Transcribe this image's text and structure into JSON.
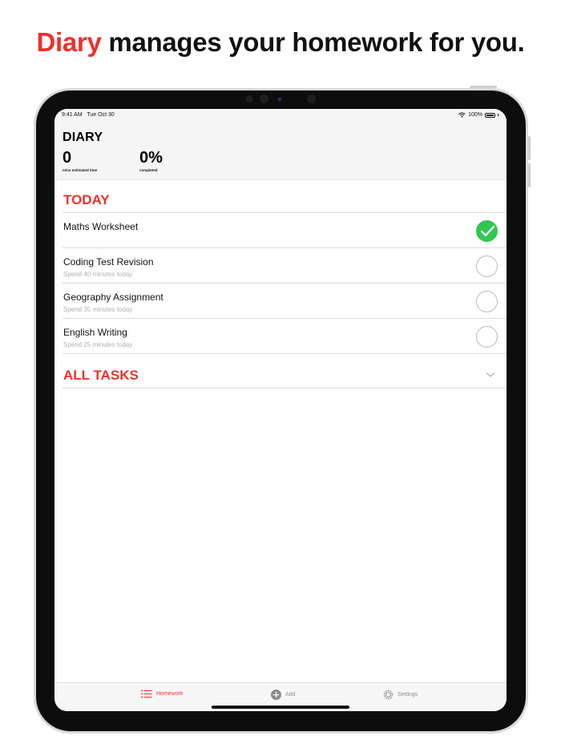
{
  "headline": {
    "accent": "Diary",
    "rest": " manages your homework for you."
  },
  "status_bar": {
    "time": "9:41 AM",
    "date": "Tue Oct 30",
    "battery": "100%"
  },
  "app": {
    "title": "DIARY",
    "stats": [
      {
        "value": "0",
        "caption": "mins estimated time"
      },
      {
        "value": "0%",
        "caption": "completed"
      }
    ]
  },
  "today": {
    "title": "TODAY",
    "tasks": [
      {
        "name": "Maths Worksheet",
        "subtitle": "",
        "done": true
      },
      {
        "name": "Coding Test Revision",
        "subtitle": "Spend 40 minutes today",
        "done": false
      },
      {
        "name": "Geography Assignment",
        "subtitle": "Spend 35 minutes today",
        "done": false
      },
      {
        "name": "English Writing",
        "subtitle": "Spend 25 minutes today",
        "done": false
      }
    ]
  },
  "all_tasks": {
    "title": "ALL TASKS"
  },
  "tabbar": {
    "homework": "Homework",
    "add": "Add",
    "settings": "Settings",
    "active": "homework"
  },
  "colors": {
    "accent": "#f0302b",
    "done_green": "#30c850"
  },
  "icons": {
    "check": "checkmark-icon",
    "chevron": "chevron-down-icon",
    "list": "list-icon",
    "add": "plus-circle-icon",
    "settings": "gear-icon",
    "wifi": "wifi-icon",
    "battery": "battery-icon"
  }
}
